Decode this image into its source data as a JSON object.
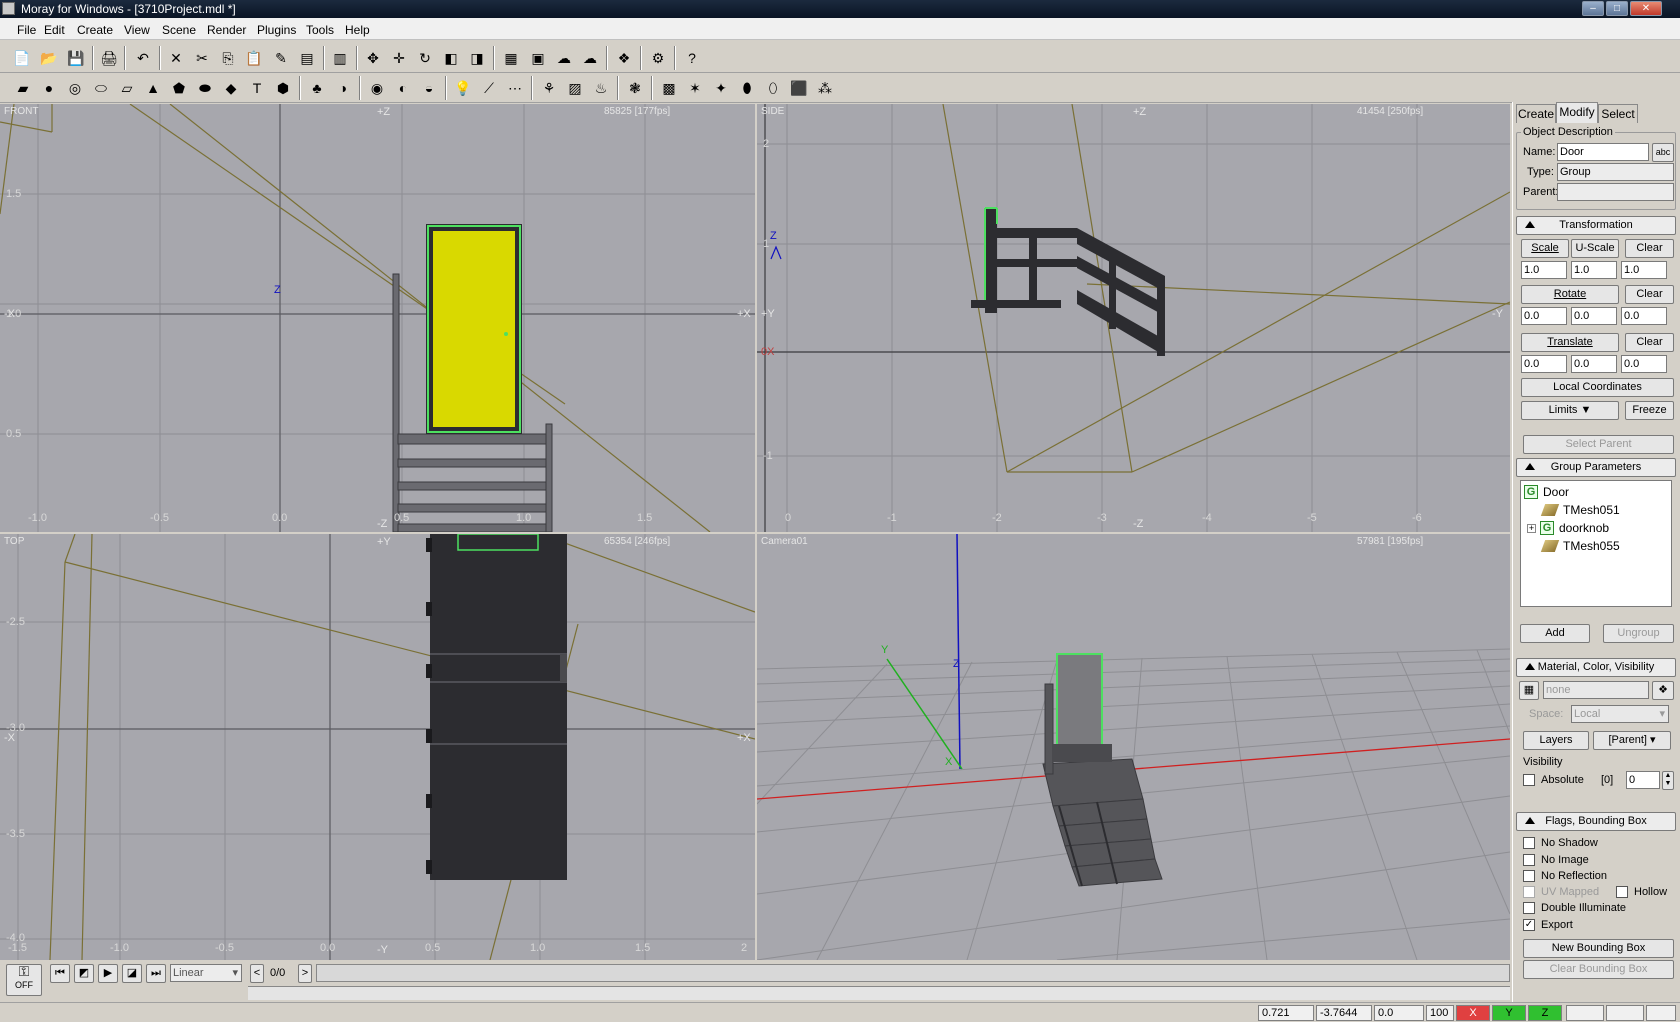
{
  "window": {
    "title": "Moray for Windows - [3710Project.mdl *]",
    "controls": [
      "–",
      "□",
      "✕"
    ]
  },
  "menu": [
    "File",
    "Edit",
    "Create",
    "View",
    "Scene",
    "Render",
    "Plugins",
    "Tools",
    "Help"
  ],
  "viewports": {
    "front": {
      "label": "FRONT",
      "info": "85825   [177fps]",
      "axis_top": "+Z",
      "axis_bottom": "-Z",
      "axis_left": "-X",
      "axis_right": "+X",
      "axis_marker": "Z",
      "yticks": [
        "1.5",
        "1.0",
        "0.5"
      ],
      "xticks": [
        "-1.0",
        "-0.5",
        "0.0",
        "0.5",
        "1.0",
        "1.5"
      ]
    },
    "side": {
      "label": "SIDE",
      "info": "41454   [250fps]",
      "axis_top": "+Z",
      "axis_bottom": "-Z",
      "axis_left": "+Y",
      "axis_right": "-Y",
      "axis_origin": "0X",
      "axis_marker": "Z",
      "yticks": [
        "2",
        "1",
        "-1"
      ],
      "xticks": [
        "0",
        "-1",
        "-2",
        "-3",
        "-4",
        "-5",
        "-6"
      ]
    },
    "top": {
      "label": "TOP",
      "info": "65354   [246fps]",
      "axis_top": "+Y",
      "axis_bottom": "-Y",
      "axis_left": "-X",
      "axis_right": "+X",
      "yticks": [
        "-2.5",
        "-3.0",
        "-3.5",
        "-4.0"
      ],
      "xticks": [
        "-1.5",
        "-1.0",
        "-0.5",
        "0.0",
        "0.5",
        "1.0",
        "1.5",
        "2"
      ]
    },
    "camera": {
      "label": "Camera01",
      "info": "57981   [195fps]",
      "axis_y": "Y",
      "axis_z": "Z",
      "axis_x": "X"
    }
  },
  "panel": {
    "tabs": [
      "Create",
      "Modify",
      "Select"
    ],
    "object_description": {
      "title": "Object Description",
      "name_label": "Name:",
      "name_value": "Door",
      "name_btn": "abc",
      "type_label": "Type:",
      "type_value": "Group",
      "parent_label": "Parent:",
      "parent_value": ""
    },
    "transformation": {
      "title": "Transformation",
      "scale": "Scale",
      "uscale": "U-Scale",
      "clear": "Clear",
      "scale_vals": [
        "1.0",
        "1.0",
        "1.0"
      ],
      "rotate": "Rotate",
      "rotate_vals": [
        "0.0",
        "0.0",
        "0.0"
      ],
      "translate": "Translate",
      "translate_vals": [
        "0.0",
        "0.0",
        "0.0"
      ],
      "local": "Local Coordinates",
      "limits": "Limits",
      "freeze": "Freeze"
    },
    "select_parent": "Select Parent",
    "group_params": {
      "title": "Group Parameters",
      "tree": [
        "Door",
        "TMesh051",
        "doorknob",
        "TMesh055"
      ],
      "expand": "+",
      "add": "Add",
      "ungroup": "Ungroup"
    },
    "material": {
      "title": "Material, Color, Visibility",
      "material_value": "none",
      "space_label": "Space:",
      "space_value": "Local",
      "layers": "Layers",
      "parent_value": "[Parent]",
      "visibility": "Visibility",
      "absolute": "Absolute",
      "vis_bracket": "[0]",
      "vis_value": "0"
    },
    "flags": {
      "title": "Flags, Bounding Box",
      "no_shadow": "No Shadow",
      "no_image": "No Image",
      "no_reflection": "No Reflection",
      "uv_mapped": "UV Mapped",
      "hollow": "Hollow",
      "double_illuminate": "Double Illuminate",
      "export": "Export",
      "new_bbox": "New Bounding Box",
      "clear_bbox": "Clear Bounding Box",
      "check": "✓"
    }
  },
  "animation": {
    "key_label": "OFF",
    "interp": "Linear",
    "frame": "0/0",
    "prev": "<",
    "next": ">"
  },
  "status": {
    "x": "0.721",
    "y": "-3.7644",
    "z": "0.0",
    "zoom": "100",
    "ax_x": "X",
    "ax_y": "Y",
    "ax_z": "Z"
  },
  "colors": {
    "viewport_bg": "#a7a7ad",
    "door_yellow": "#d9d900",
    "select_green": "#4de060",
    "axis_x": "#d02020",
    "axis_y": "#20b020",
    "axis_z": "#1010c0"
  }
}
